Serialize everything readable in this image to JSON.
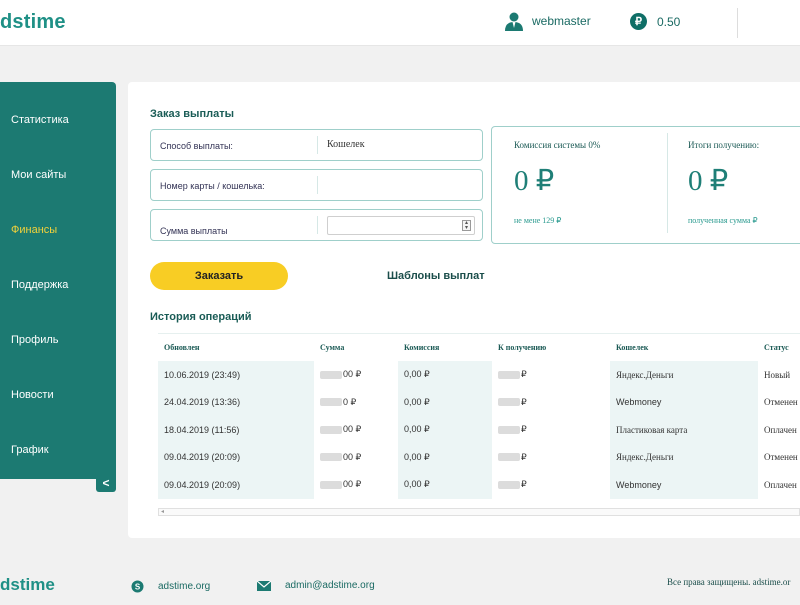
{
  "header": {
    "logo": "dstime",
    "user": "webmaster",
    "balance_currency": "₽",
    "balance": "0.50"
  },
  "sidebar": {
    "items": [
      {
        "label": "Статистика",
        "active": false
      },
      {
        "label": "Мои сайты",
        "active": false
      },
      {
        "label": "Финансы",
        "active": true
      },
      {
        "label": "Поддержка",
        "active": false
      },
      {
        "label": "Профиль",
        "active": false
      },
      {
        "label": "Новости",
        "active": false
      },
      {
        "label": "График",
        "active": false
      }
    ],
    "collapse_icon": "<"
  },
  "payout": {
    "title": "Заказ выплаты",
    "method_label": "Способ выплаты:",
    "method_value": "Кошелек",
    "card_label": "Номер карты / кошелька:",
    "card_value": "",
    "amount_label": "Сумма выплаты",
    "amount_value": ""
  },
  "info": {
    "commission_caption": "Комиссия системы 0%",
    "commission_value": "0 ₽",
    "commission_note": "не мене 129 ₽",
    "total_caption": "Итоги получению:",
    "total_value": "0 ₽",
    "total_note": "полученная сумма ₽"
  },
  "actions": {
    "order_button": "Заказать",
    "templates_link": "Шаблоны выплат"
  },
  "history": {
    "title": "История операций",
    "columns": [
      "Обновлен",
      "Сумма",
      "Комиссия",
      "К получению",
      "Кошелек",
      "Статус"
    ],
    "rows": [
      {
        "updated": "10.06.2019 (23:49)",
        "amount": "00 ₽",
        "commission": "0,00 ₽",
        "receive": "₽",
        "wallet": "Яндекс.Деньги",
        "status": "Новый"
      },
      {
        "updated": "24.04.2019 (13:36)",
        "amount": "0 ₽",
        "commission": "0,00 ₽",
        "receive": "₽",
        "wallet": "Webmoney",
        "status": "Отменен"
      },
      {
        "updated": "18.04.2019 (11:56)",
        "amount": "00 ₽",
        "commission": "0,00 ₽",
        "receive": "₽",
        "wallet": "Пластиковая карта",
        "status": "Оплачен"
      },
      {
        "updated": "09.04.2019 (20:09)",
        "amount": "00 ₽",
        "commission": "0,00 ₽",
        "receive": "₽",
        "wallet": "Яндекс.Деньги",
        "status": "Отменен"
      },
      {
        "updated": "09.04.2019 (20:09)",
        "amount": "00 ₽",
        "commission": "0,00 ₽",
        "receive": "₽",
        "wallet": "Webmoney",
        "status": "Оплачен"
      }
    ]
  },
  "footer": {
    "logo": "dstime",
    "skype": "adstime.org",
    "email": "admin@adstime.org",
    "copyright": "Все права защищены. adstime.or"
  },
  "colors": {
    "brand": "#1c7a72",
    "accent": "#f8cd24",
    "active_menu": "#f3d23a"
  }
}
